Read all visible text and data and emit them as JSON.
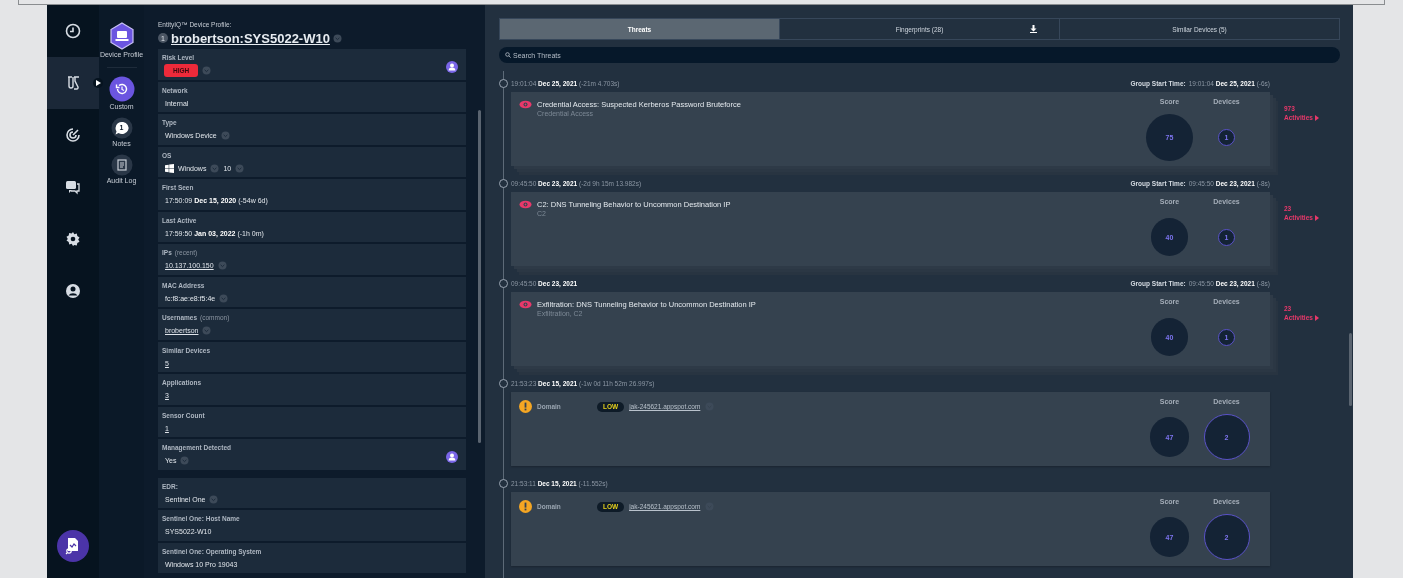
{
  "nav_rail": [
    {
      "kind": "history",
      "selected": false
    },
    {
      "kind": "lab",
      "selected": true
    },
    {
      "kind": "radar",
      "selected": false
    },
    {
      "kind": "chat",
      "selected": false
    },
    {
      "kind": "settings",
      "selected": false
    },
    {
      "kind": "user",
      "selected": false
    }
  ],
  "report_button": {
    "kind": "report"
  },
  "tool_rail": [
    {
      "kind": "device",
      "label": "Device Profile"
    },
    {
      "kind": "custom",
      "label": "Custom"
    },
    {
      "kind": "notes",
      "label": "Notes",
      "badge": "1"
    },
    {
      "kind": "audit",
      "label": "Audit Log"
    }
  ],
  "profile": {
    "heading": "EntityIQ™ Device Profile:",
    "badge": "1",
    "title": "brobertson:SYS5022-W10",
    "sections": [
      {
        "fields": [
          {
            "label": "Risk Level",
            "kind": "badge",
            "values": [
              {
                "text": "HIGH",
                "menu": true
              }
            ],
            "user_icon": true
          },
          {
            "label": "Network",
            "kind": "text",
            "values": [
              {
                "text": "Internal",
                "menu": false
              }
            ]
          },
          {
            "label": "Type",
            "kind": "text",
            "values": [
              {
                "text": "Windows Device",
                "menu": true
              }
            ]
          },
          {
            "label": "OS",
            "kind": "os",
            "values": [
              {
                "text": "Windows",
                "menu": true
              },
              {
                "text": "10",
                "menu": true
              }
            ]
          },
          {
            "label": "First Seen",
            "kind": "text",
            "values": [
              {
                "text": "17:50:09 **Dec 15, 2020** (-54w 6d)",
                "menu": false
              }
            ]
          },
          {
            "label": "Last Active",
            "kind": "text",
            "values": [
              {
                "text": "17:59:50 **Jan 03, 2022** (-1h 0m)",
                "menu": false
              }
            ]
          },
          {
            "label": "IPs",
            "label_note": "(recent)",
            "kind": "link",
            "values": [
              {
                "text": "10.137.100.150",
                "menu": true
              }
            ]
          },
          {
            "label": "MAC Address",
            "kind": "text",
            "values": [
              {
                "text": "fc:f8:ae:e8:f5:4e",
                "menu": true
              }
            ]
          },
          {
            "label": "Usernames",
            "label_note": "(common)",
            "kind": "link",
            "values": [
              {
                "text": "brobertson",
                "menu": true
              }
            ]
          },
          {
            "label": "Similar Devices",
            "kind": "link",
            "values": [
              {
                "text": "5",
                "menu": false
              }
            ]
          },
          {
            "label": "Applications",
            "kind": "link",
            "values": [
              {
                "text": "3",
                "menu": false
              }
            ]
          },
          {
            "label": "Sensor Count",
            "kind": "link",
            "values": [
              {
                "text": "1",
                "menu": false
              }
            ]
          },
          {
            "label": "Management Detected",
            "kind": "text",
            "values": [
              {
                "text": "Yes",
                "menu": true
              }
            ],
            "user_icon": true
          }
        ]
      },
      {
        "fields": [
          {
            "label": "EDR:",
            "kind": "text",
            "values": [
              {
                "text": "Sentinel One",
                "menu": true
              }
            ]
          },
          {
            "label": "Sentinel One: Host Name",
            "kind": "text",
            "values": [
              {
                "text": "SYS5022-W10",
                "menu": false
              }
            ]
          },
          {
            "label": "Sentinel One: Operating System",
            "kind": "text",
            "values": [
              {
                "text": "Windows 10 Pro 19043",
                "menu": false
              }
            ]
          }
        ]
      }
    ]
  },
  "tabs": [
    {
      "label": "Threats",
      "selected": true
    },
    {
      "label": "Fingerprints (28)",
      "selected": false,
      "download": true
    },
    {
      "label": "Similar Devices (5)",
      "selected": false
    }
  ],
  "search": {
    "placeholder": "Search Threats"
  },
  "timeline": [
    {
      "kind": "threat",
      "time": "19:01:04 **Dec 25, 2021** (-21m 4.703s)",
      "group_start_label": "Group Start Time:",
      "group_start": "19:01:04 **Dec 25, 2021** (-6s)",
      "title": "Credential Access: Suspected Kerberos Password Bruteforce",
      "subtitle": "Credential Access",
      "score_label": "Score",
      "score": "75",
      "devices_label": "Devices",
      "devices": "1",
      "activities_count": "973",
      "activities_label": "Activities",
      "stacked": true
    },
    {
      "kind": "threat",
      "time": "09:45:50 **Dec 23, 2021** (-2d 9h 15m 13.982s)",
      "group_start_label": "Group Start Time:",
      "group_start": "09:45:50 **Dec 23, 2021** (-8s)",
      "title": "C2: DNS Tunneling Behavior to Uncommon Destination IP",
      "subtitle": "C2",
      "score_label": "Score",
      "score": "40",
      "devices_label": "Devices",
      "devices": "1",
      "activities_count": "23",
      "activities_label": "Activities",
      "stacked": true
    },
    {
      "kind": "threat",
      "time": "09:45:50 **Dec 23, 2021**",
      "group_start_label": "Group Start Time:",
      "group_start": "09:45:50 **Dec 23, 2021** (-8s)",
      "title": "Exfiltration: DNS Tunneling Behavior to Uncommon Destination IP",
      "subtitle": "Exfiltration, C2",
      "score_label": "Score",
      "score": "40",
      "devices_label": "Devices",
      "devices": "1",
      "activities_count": "23",
      "activities_label": "Activities",
      "stacked": true
    },
    {
      "kind": "domain",
      "time": "21:53:23 **Dec 15, 2021** (-1w 0d 11h 52m 26.997s)",
      "title": "Domain",
      "severity": "LOW",
      "link": "jak-245621.appspot.com",
      "menu": true,
      "score_label": "Score",
      "score": "47",
      "devices_label": "Devices",
      "devices": "2",
      "stacked": false
    },
    {
      "kind": "domain",
      "time": "21:53:11 **Dec 15, 2021** (-11.552s)",
      "title": "Domain",
      "severity": "LOW",
      "link": "jak-245621.appspot.com",
      "menu": true,
      "score_label": "Score",
      "score": "47",
      "devices_label": "Devices",
      "devices": "2",
      "stacked": false
    }
  ]
}
